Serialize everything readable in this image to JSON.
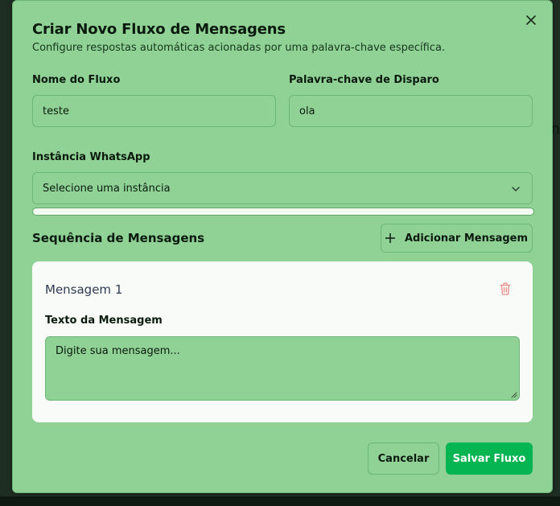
{
  "dialog": {
    "title": "Criar Novo Fluxo de Mensagens",
    "subtitle": "Configure respostas automáticas acionadas por uma palavra-chave específica.",
    "close_icon": "close-icon"
  },
  "form": {
    "flow_name_label": "Nome do Fluxo",
    "flow_name_value": "teste",
    "keyword_label": "Palavra-chave de Disparo",
    "keyword_value": "ola",
    "instance_label": "Instância WhatsApp",
    "instance_placeholder": "Selecione uma instância"
  },
  "sequence": {
    "title": "Sequência de Mensagens",
    "add_button_label": "Adicionar Mensagem",
    "messages": [
      {
        "title": "Mensagem 1",
        "text_label": "Texto da Mensagem",
        "text_placeholder": "Digite sua mensagem..."
      }
    ]
  },
  "footer": {
    "cancel_label": "Cancelar",
    "save_label": "Salvar Fluxo"
  },
  "background": {
    "partial_text": "n"
  },
  "colors": {
    "modal_bg": "#90d296",
    "primary": "#04b552",
    "card_bg": "#f8fbf7",
    "delete_icon": "#e57373"
  }
}
